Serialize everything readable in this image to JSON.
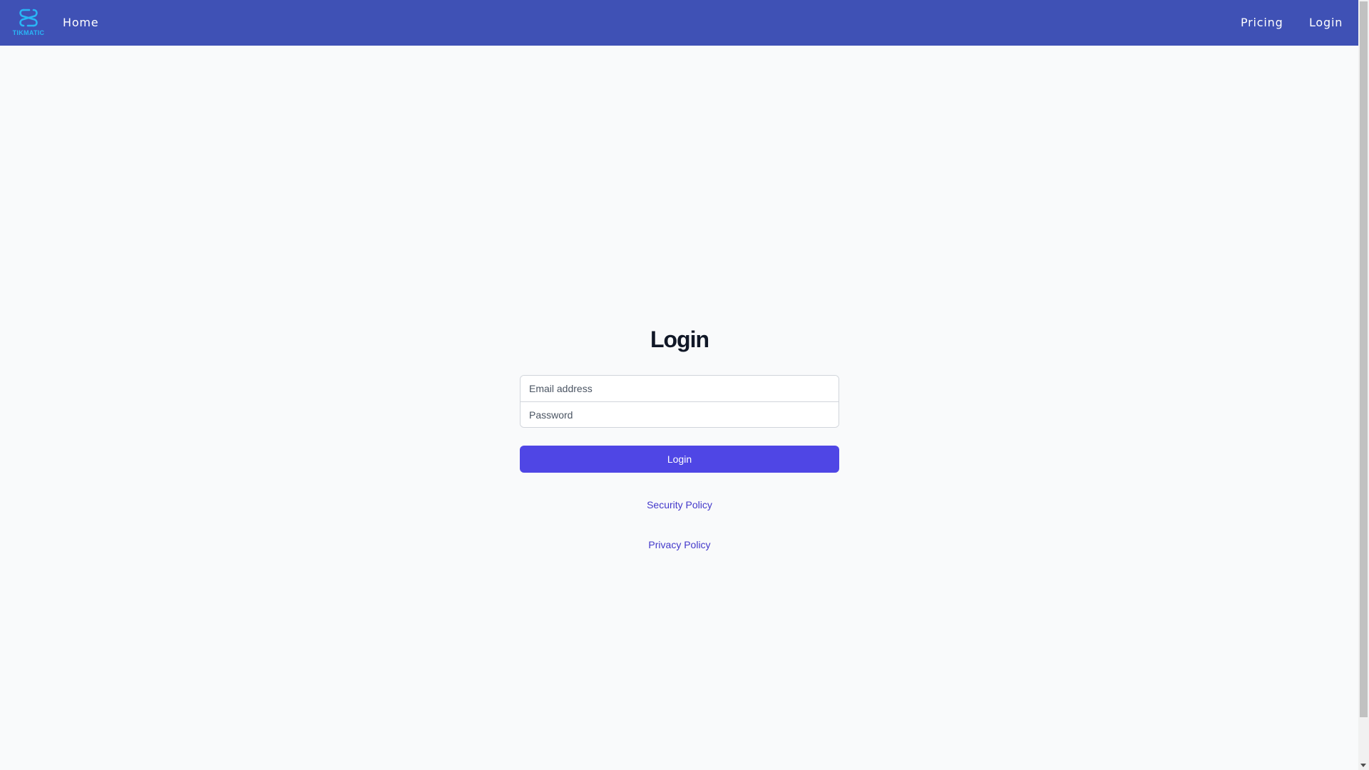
{
  "brand": {
    "logo_text": "TIKMATIC",
    "logo_color": "#29b6f6"
  },
  "navbar": {
    "background": "#3f51b5",
    "home_label": "Home",
    "pricing_label": "Pricing",
    "login_label": "Login"
  },
  "login_form": {
    "title": "Login",
    "email_placeholder": "Email address",
    "password_placeholder": "Password",
    "submit_label": "Login",
    "button_color": "#4f46e5"
  },
  "footer_links": {
    "security_policy": "Security Policy",
    "privacy_policy": "Privacy Policy",
    "link_color": "#4338ca"
  }
}
